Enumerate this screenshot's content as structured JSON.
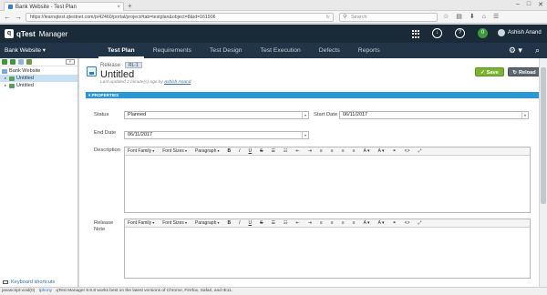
{
  "browser": {
    "tab_title": "Bank Website - Test Plan",
    "tab_close": "×",
    "new_tab": "+",
    "window_controls": [
      "–",
      "□",
      "✕"
    ],
    "url": "https://learnqtest.qtestnet.com/p/42460/portal/project#tab=testplan&object=8&id=161906",
    "reload_icon": "↻",
    "search_placeholder": "Search",
    "back_icon": "←",
    "forward_icon": "→",
    "toolbar_icons": [
      "☆",
      "▤",
      "⬇",
      "⌂",
      "☰"
    ]
  },
  "app": {
    "logo_letter": "q",
    "logo_name": "qTest",
    "logo_product": "Manager",
    "header_icons": {
      "help": "?",
      "download": "↓",
      "bell_badge": "0"
    },
    "user_name": "Ashish Anand",
    "project": "Bank Website ▾",
    "modules": [
      "Test Plan",
      "Requirements",
      "Test Design",
      "Test Execution",
      "Defects",
      "Reports"
    ],
    "active_module": "Test Plan",
    "nav_right_icons": {
      "settings": "⚙ ▾",
      "search": "⌕"
    }
  },
  "tree": {
    "collapse_icon": "«",
    "root": "Bank Website",
    "items": [
      "Untitled",
      "Untitled"
    ],
    "expander": "▸",
    "keyboard_shortcuts": "Keyboard shortcuts"
  },
  "release": {
    "label": "Release",
    "badge": "RL-1",
    "title": "Untitled",
    "updated_prefix": "Last updated 2 minute(s) ago by ",
    "updated_by": "Ashish Anand",
    "save_icon": "✓",
    "save_label": "Save",
    "reload_icon": "↻",
    "reload_label": "Reload"
  },
  "properties": {
    "header": "▾ PROPERTIES",
    "status_label": "Status",
    "status_value": "Planned",
    "start_date_label": "Start Date",
    "start_date_value": "06/11/2017",
    "end_date_label": "End Date",
    "end_date_value": "06/11/2017",
    "description_label": "Description",
    "release_note_label_1": "Release",
    "release_note_label_2": "Note",
    "dropdown_arrow": "▾"
  },
  "editor_toolbar": {
    "font_family": "Font Family",
    "font_sizes": "Font Sizes",
    "paragraph": "Paragraph",
    "bold": "B",
    "italic": "I",
    "underline": "U",
    "strike": "S",
    "bullets": "☰",
    "numbers": "☷",
    "outdent": "⇤",
    "indent": "⇥",
    "align_left": "≡",
    "align_center": "≡",
    "align_right": "≡",
    "justify": "≡",
    "text_color": "A ▾",
    "bg_color": "A ▾",
    "link": "⚭",
    "code": "<>",
    "fullscreen": "⤢"
  },
  "status_bar": {
    "script_text": "javascript:void(0)",
    "link_1": "tphony",
    "message": "qTest Manager 8.6.8 works best on the latest versions of Chrome, Firefox, Safari, and IE11."
  },
  "colors": {
    "header_bg": "#1b2a39",
    "module_nav_bg": "#223447",
    "properties_bar": "#2a96d8",
    "save_button": "#79b530",
    "reload_button": "#5f6870",
    "tree_selected": "#c7e0f4"
  }
}
